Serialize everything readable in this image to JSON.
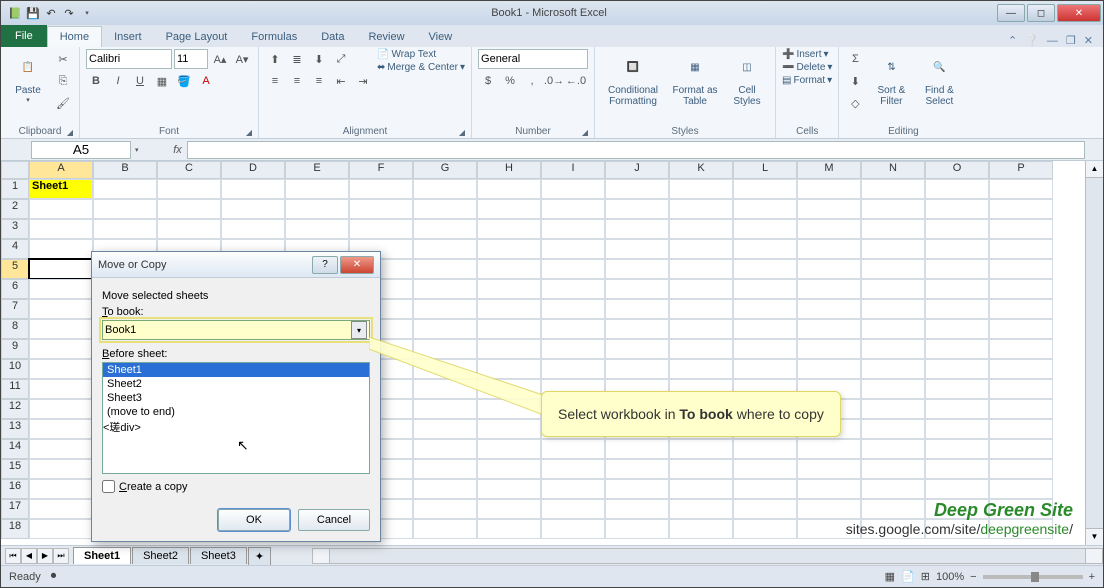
{
  "app": {
    "title": "Book1 - Microsoft Excel"
  },
  "tabs": {
    "file": "File",
    "home": "Home",
    "insert": "Insert",
    "page_layout": "Page Layout",
    "formulas": "Formulas",
    "data": "Data",
    "review": "Review",
    "view": "View"
  },
  "ribbon": {
    "clipboard": {
      "label": "Clipboard",
      "paste": "Paste"
    },
    "font": {
      "label": "Font",
      "name": "Calibri",
      "size": "11"
    },
    "alignment": {
      "label": "Alignment",
      "wrap": "Wrap Text",
      "merge": "Merge & Center"
    },
    "number": {
      "label": "Number",
      "format": "General"
    },
    "styles": {
      "label": "Styles",
      "cond": "Conditional Formatting",
      "table": "Format as Table",
      "cell": "Cell Styles"
    },
    "cells": {
      "label": "Cells",
      "insert": "Insert",
      "delete": "Delete",
      "format": "Format"
    },
    "editing": {
      "label": "Editing",
      "sort": "Sort & Filter",
      "find": "Find & Select"
    }
  },
  "namebox": "A5",
  "columns": [
    "A",
    "B",
    "C",
    "D",
    "E",
    "F",
    "G",
    "H",
    "I",
    "J",
    "K",
    "L",
    "M",
    "N",
    "O",
    "P"
  ],
  "rows": [
    "1",
    "2",
    "3",
    "4",
    "5",
    "6",
    "7",
    "8",
    "9",
    "10",
    "11",
    "12",
    "13",
    "14",
    "15",
    "16",
    "17",
    "18"
  ],
  "cells": {
    "A1": "Sheet1"
  },
  "sheets": {
    "s1": "Sheet1",
    "s2": "Sheet2",
    "s3": "Sheet3"
  },
  "status": {
    "ready": "Ready",
    "zoom": "100%"
  },
  "dialog": {
    "title": "Move or Copy",
    "msg": "Move selected sheets",
    "tobook_lbl": "To book:",
    "tobook_val": "Book1",
    "before_lbl": "Before sheet:",
    "list": {
      "i0": "Sheet1",
      "i1": "Sheet2",
      "i2": "Sheet3",
      "i3": "(move to end)"
    },
    "copy_lbl": "Create a copy",
    "ok": "OK",
    "cancel": "Cancel"
  },
  "callout": {
    "pre": "Select workbook in ",
    "bold": "To book",
    "post": " where to copy"
  },
  "watermark": {
    "brand": "Deep Green Site",
    "u1": "sites.google.com/site/",
    "u2": "deepgreensite",
    "u3": "/"
  }
}
